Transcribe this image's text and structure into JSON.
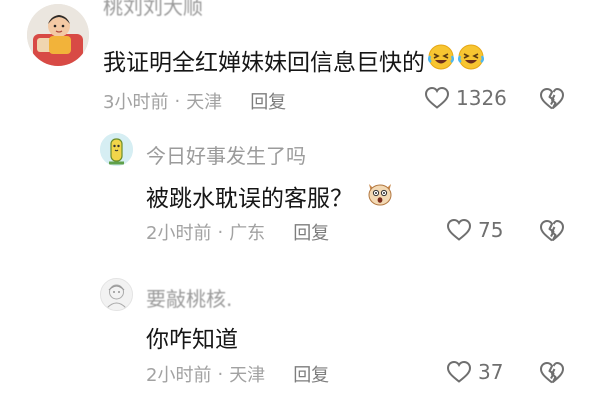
{
  "comments": [
    {
      "username": "桃刘刘大顺",
      "text": "我证明全红婵妹妹回信息巨快的",
      "emojis": [
        "rofl-emoji",
        "rofl-emoji"
      ],
      "time": "3小时前",
      "location": "天津",
      "reply_label": "回复",
      "like_count": "1326"
    },
    {
      "username": "今日好事发生了吗",
      "text": "被跳水耽误的客服？",
      "emojis": [
        "shocked-dog-emoji"
      ],
      "time": "2小时前",
      "location": "广东",
      "reply_label": "回复",
      "like_count": "75"
    },
    {
      "username": "要敲桃核.",
      "text": "你咋知道",
      "emojis": [],
      "time": "2小时前",
      "location": "天津",
      "reply_label": "回复",
      "like_count": "37"
    }
  ],
  "separator": "·",
  "colors": {
    "primary_text": "#161616",
    "secondary_text": "#a2a2a2",
    "icon": "#6f6f6f",
    "background": "#ffffff"
  }
}
